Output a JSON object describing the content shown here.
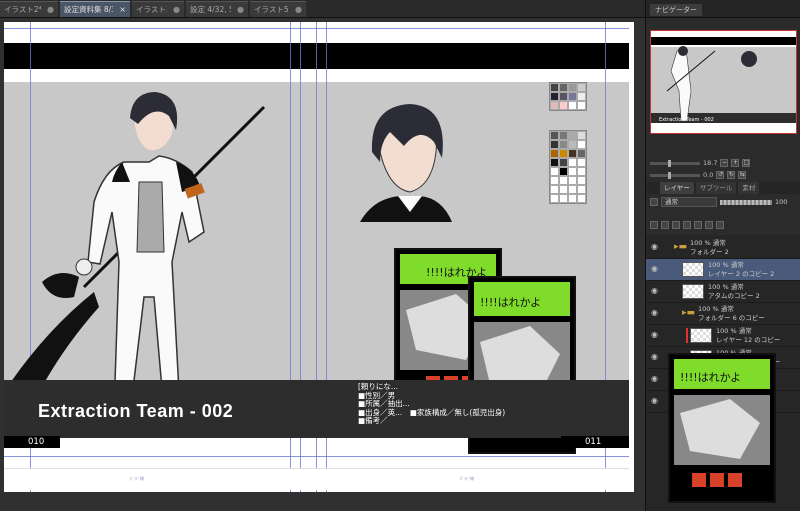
{
  "tabs": [
    {
      "label": "イラスト2*",
      "active": false
    },
    {
      "label": "設定資料集 8/32, 9/32",
      "active": true
    },
    {
      "label": "イラスト3*",
      "active": false
    },
    {
      "label": "設定 4/32, 5/32",
      "active": false
    },
    {
      "label": "イラスト5*",
      "active": false
    }
  ],
  "canvas": {
    "title": "Extraction Team - 002",
    "info_lines": [
      "[頼りにな...",
      "■性別／男",
      "■所属／抽出...",
      "■出身／英...　■家族構成／無し(孤児出身)",
      "■備考／"
    ],
    "page_left": "010",
    "page_right": "011",
    "card_text": "!!!!はれかよ",
    "tiny_label": "ｶﾞｲﾄﾞ線"
  },
  "navigator": {
    "tab_label": "ナビゲーター",
    "zoom_value": "18.7",
    "rotate_value": "0.0",
    "thumb_title": "Extraction Team - 002"
  },
  "layer_panel": {
    "tabs": [
      "レイヤー",
      "サブツール",
      "素材"
    ],
    "blend_mode": "通常",
    "opacity": "100",
    "layers": [
      {
        "name": "100 % 通常\nフォルダー 2",
        "type": "folder",
        "indent": 0
      },
      {
        "name": "100 % 通常\nレイヤー 2 のコピー 2",
        "type": "layer",
        "indent": 1,
        "selected": true
      },
      {
        "name": "100 % 通常\nアタムのコピー 2",
        "type": "layer",
        "indent": 1
      },
      {
        "name": "100 % 通常\nフォルダー 6 のコピー",
        "type": "folder",
        "indent": 1
      },
      {
        "name": "100 % 通常\nレイヤー 12 のコピー",
        "type": "layer",
        "indent": 2,
        "red": true
      },
      {
        "name": "100 % 通常\nレイヤー 11 のコピー",
        "type": "layer",
        "indent": 2
      },
      {
        "name": "2",
        "type": "layer",
        "indent": 2
      },
      {
        "name": "2",
        "type": "layer",
        "indent": 2
      }
    ]
  },
  "colors": {
    "accent": "#4a5566",
    "guide": "#6b7bd6",
    "card_green": "#7fdc2a",
    "card_red": "#d8422a",
    "armband": "#c0661c"
  },
  "icons": [
    "eye-icon",
    "folder-icon",
    "close-icon",
    "brush-icon"
  ]
}
